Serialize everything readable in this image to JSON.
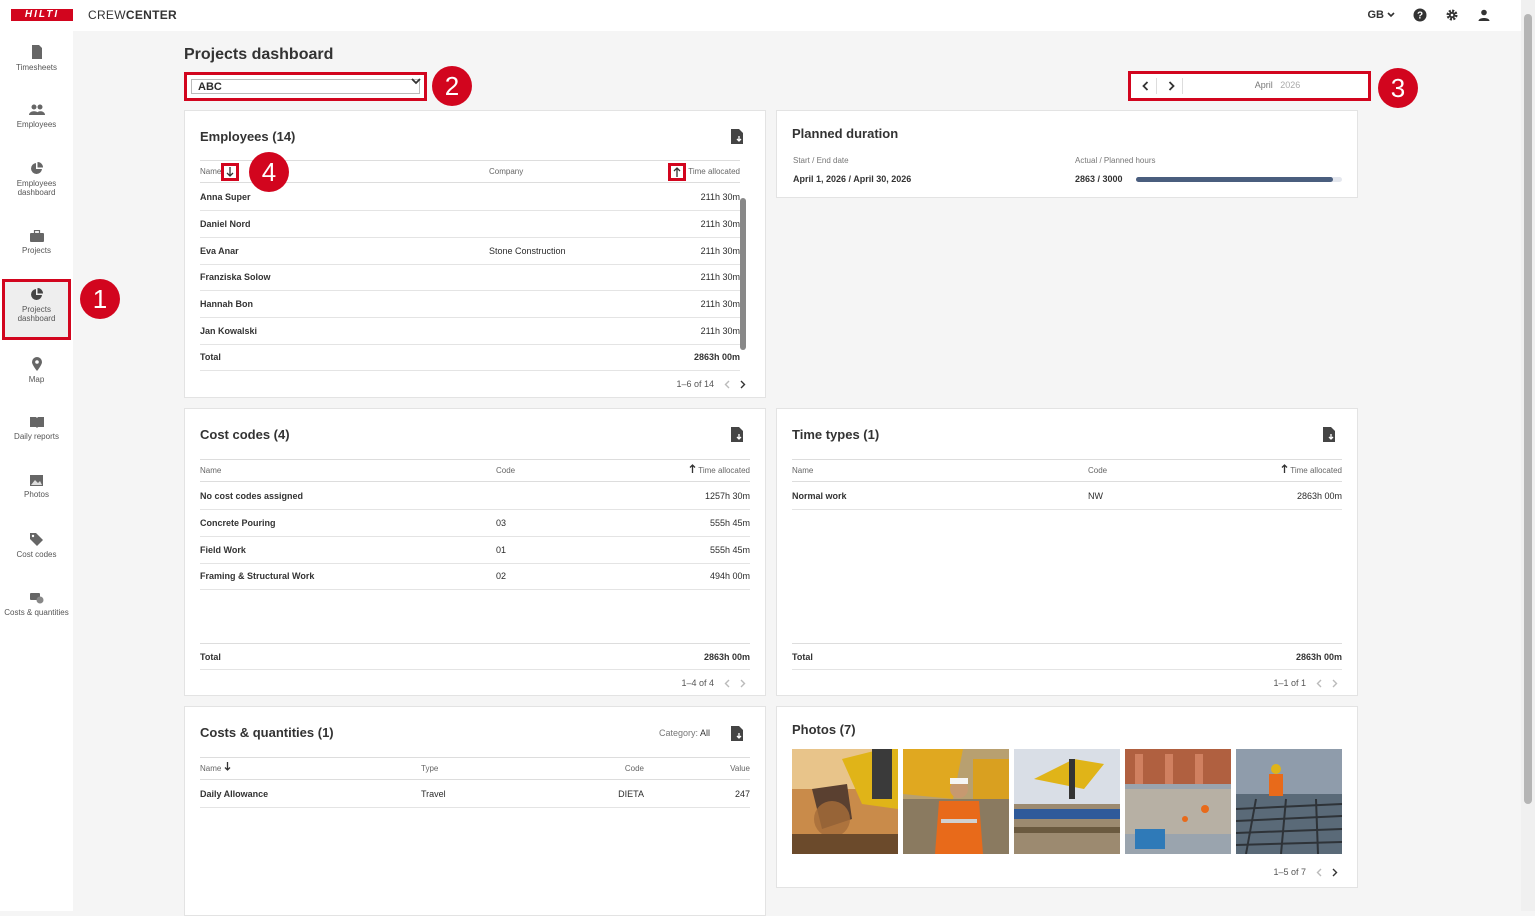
{
  "header": {
    "logo_text": "HILTI",
    "app_name_light": "CREW",
    "app_name_bold": "CENTER",
    "language": "GB",
    "icons": [
      "help-icon",
      "gear-icon",
      "user-icon"
    ],
    "brand_color": "#d2051e"
  },
  "sidebar": {
    "items": [
      {
        "label": "Timesheets",
        "icon": "document-icon"
      },
      {
        "label": "Employees",
        "icon": "people-icon"
      },
      {
        "label": "Employees dashboard",
        "icon": "pie-chart-icon"
      },
      {
        "label": "Projects",
        "icon": "briefcase-icon"
      },
      {
        "label": "Projects dashboard",
        "icon": "pie-chart-icon",
        "active": true
      },
      {
        "label": "Map",
        "icon": "map-pin-icon"
      },
      {
        "label": "Daily reports",
        "icon": "book-icon"
      },
      {
        "label": "Photos",
        "icon": "image-icon"
      },
      {
        "label": "Cost codes",
        "icon": "tag-icon"
      },
      {
        "label": "Costs & quantities",
        "icon": "coins-icon"
      }
    ]
  },
  "annotations": [
    "1",
    "2",
    "3",
    "4"
  ],
  "page_title": "Projects dashboard",
  "project_select": {
    "value": "ABC"
  },
  "date_nav": {
    "month": "April",
    "year": "2026"
  },
  "employees": {
    "title": "Employees (14)",
    "columns": {
      "name": "Name",
      "company": "Company",
      "time": "Time allocated"
    },
    "rows": [
      {
        "name": "Anna Super",
        "company": "",
        "time": "211h 30m"
      },
      {
        "name": "Daniel Nord",
        "company": "",
        "time": "211h 30m"
      },
      {
        "name": "Eva Anar",
        "company": "Stone Construction",
        "time": "211h 30m"
      },
      {
        "name": "Franziska Solow",
        "company": "",
        "time": "211h 30m"
      },
      {
        "name": "Hannah Bon",
        "company": "",
        "time": "211h 30m"
      },
      {
        "name": "Jan Kowalski",
        "company": "",
        "time": "211h 30m"
      }
    ],
    "total_label": "Total",
    "total_value": "2863h 00m",
    "pager": "1–6 of 14"
  },
  "planned_duration": {
    "title": "Planned duration",
    "dates_label": "Start / End date",
    "dates_value": "April 1, 2026 / April 30, 2026",
    "hours_label": "Actual / Planned hours",
    "hours_value": "2863 / 3000",
    "progress_fraction": 0.954
  },
  "cost_codes": {
    "title": "Cost codes (4)",
    "columns": {
      "name": "Name",
      "code": "Code",
      "time": "Time allocated"
    },
    "rows": [
      {
        "name": "No cost codes assigned",
        "code": "",
        "time": "1257h 30m"
      },
      {
        "name": "Concrete Pouring",
        "code": "03",
        "time": "555h 45m"
      },
      {
        "name": "Field Work",
        "code": "01",
        "time": "555h 45m"
      },
      {
        "name": "Framing & Structural Work",
        "code": "02",
        "time": "494h 00m"
      }
    ],
    "total_label": "Total",
    "total_value": "2863h 00m",
    "pager": "1–4 of 4"
  },
  "time_types": {
    "title": "Time types (1)",
    "columns": {
      "name": "Name",
      "code": "Code",
      "time": "Time allocated"
    },
    "rows": [
      {
        "name": "Normal work",
        "code": "NW",
        "time": "2863h 00m"
      }
    ],
    "total_label": "Total",
    "total_value": "2863h 00m",
    "pager": "1–1 of 1"
  },
  "costs_quantities": {
    "title": "Costs & quantities (1)",
    "category_label": "Category:",
    "category_value": "All",
    "columns": {
      "name": "Name",
      "type": "Type",
      "code": "Code",
      "value": "Value"
    },
    "rows": [
      {
        "name": "Daily Allowance",
        "type": "Travel",
        "code": "DIETA",
        "value": "247"
      }
    ]
  },
  "photos": {
    "title": "Photos (7)",
    "pager": "1–5 of 7",
    "items": [
      "excavator-digging-photo",
      "worker-in-orange-photo",
      "excavator-pipeline-photo",
      "construction-site-photo",
      "rebar-worker-photo"
    ]
  }
}
